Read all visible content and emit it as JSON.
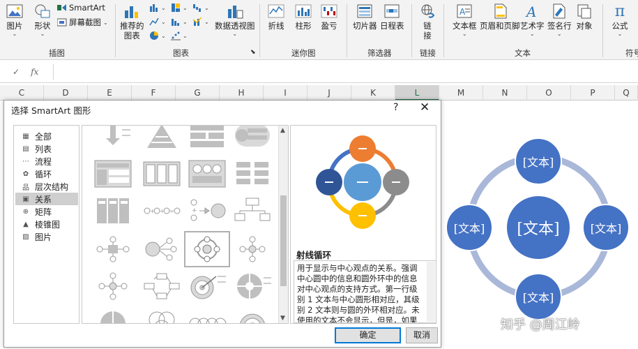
{
  "ribbon": {
    "groups": [
      {
        "label": "插图"
      },
      {
        "label": "图表"
      },
      {
        "label": "迷你图"
      },
      {
        "label": "筛选器"
      },
      {
        "label": "链接"
      },
      {
        "label": "文本"
      },
      {
        "label": "符号"
      }
    ],
    "buttons": {
      "pictures": "图片",
      "shapes": "形状",
      "smartart": "SmartArt",
      "screenshot": "屏幕截图",
      "recommended_charts_1": "推荐的",
      "recommended_charts_2": "图表",
      "pivot_chart": "数据透视图",
      "line": "折线",
      "column": "柱形",
      "winloss": "盈亏",
      "slicer": "切片器",
      "timeline": "日程表",
      "link_1": "链",
      "link_2": "接",
      "textbox": "文本框",
      "header_footer": "页眉和页脚",
      "wordart": "艺术字",
      "signature": "签名行",
      "object": "对象",
      "equation": "公式"
    }
  },
  "formula_bar": {
    "cancel": "✓",
    "fx": "fx",
    "value": ""
  },
  "columns": [
    "C",
    "D",
    "E",
    "F",
    "G",
    "H",
    "I",
    "J",
    "K",
    "L",
    "M",
    "N",
    "O",
    "P",
    "Q"
  ],
  "dialog": {
    "title": "选择 SmartArt 图形",
    "help": "?",
    "close": "✕",
    "categories": [
      {
        "label": "全部",
        "icon": "all-icon"
      },
      {
        "label": "列表",
        "icon": "list-icon"
      },
      {
        "label": "流程",
        "icon": "process-icon"
      },
      {
        "label": "循环",
        "icon": "cycle-icon"
      },
      {
        "label": "层次结构",
        "icon": "hierarchy-icon"
      },
      {
        "label": "关系",
        "icon": "relationship-icon"
      },
      {
        "label": "矩阵",
        "icon": "matrix-icon"
      },
      {
        "label": "棱锥图",
        "icon": "pyramid-icon"
      },
      {
        "label": "图片",
        "icon": "picture-icon"
      }
    ],
    "selected_category": "关系",
    "preview_title": "射线循环",
    "preview_desc": "用于显示与中心观点的关系。强调中心圆中的信息和圆外环中的信息对中心观点的支持方式。第一行级别 1 文本与中心圆形相对应，其级别 2 文本则与圆的外环相对应。未使用的文本不会显示，但是，如果切换布局，这",
    "ok": "确定",
    "cancel": "取消"
  },
  "diagram": {
    "center": "[文本]",
    "top": "[文本]",
    "left": "[文本]",
    "right": "[文本]",
    "bottom": "[文本]"
  },
  "watermark": "知乎 @周江岭",
  "colors": {
    "accent": "#217346",
    "node_blue": "#4472c4",
    "ring": "#a9b7d9"
  }
}
